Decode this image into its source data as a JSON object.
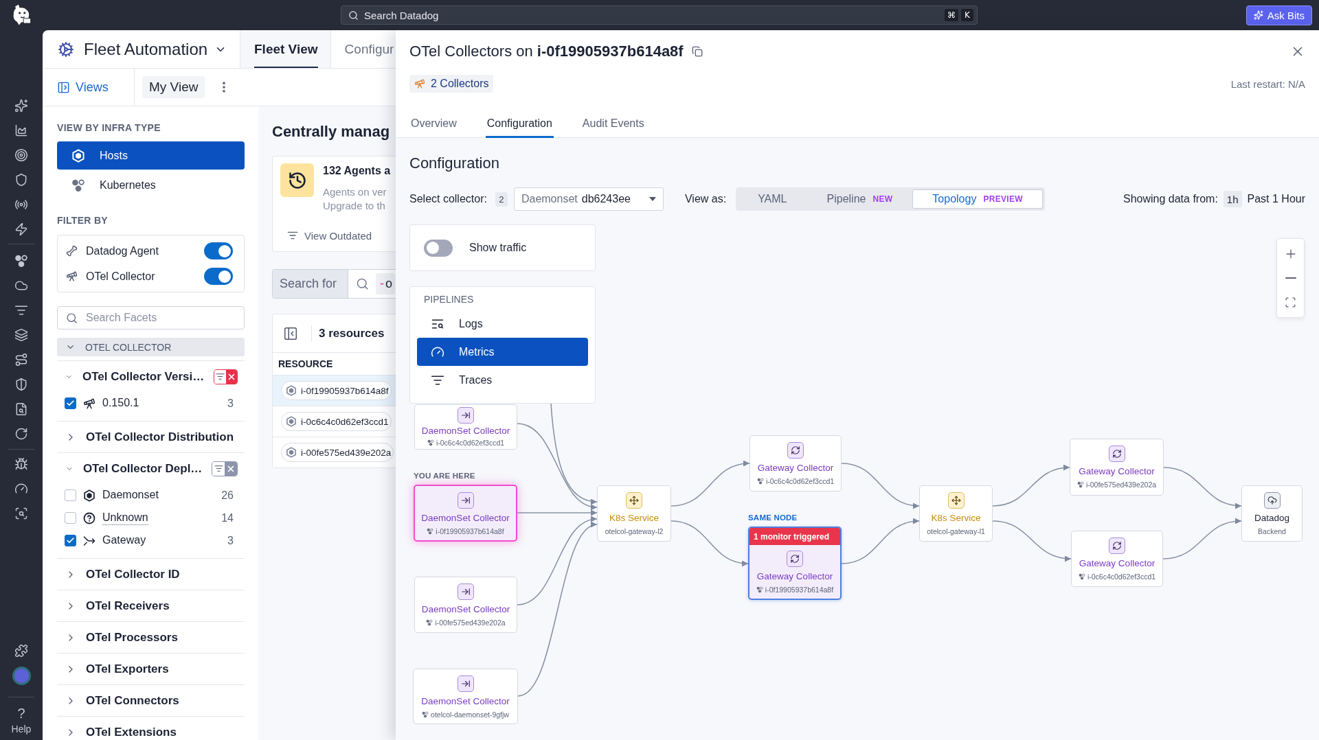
{
  "top_bar": {
    "search": {
      "placeholder": "Search Datadog",
      "shortcut": [
        "⌘",
        "K"
      ]
    },
    "ask_button": "Ask Bits"
  },
  "nav": {
    "help": {
      "glyph": "?",
      "label": "Help"
    }
  },
  "app": {
    "title": "Fleet Automation",
    "tabs": [
      {
        "label": "Fleet View",
        "selected": true
      },
      {
        "label": "Configur",
        "selected": false
      }
    ],
    "views_button": "Views",
    "current_view": "My View",
    "facets_panel": {
      "infra_title": "VIEW BY INFRA TYPE",
      "infra_types": [
        {
          "label": "Hosts",
          "kind": "host",
          "selected": true
        },
        {
          "label": "Kubernetes",
          "kind": "cluster",
          "selected": false
        }
      ],
      "filter_title": "FILTER BY",
      "filters": [
        {
          "label": "Datadog Agent",
          "kind": "agent",
          "on": true
        },
        {
          "label": "OTel Collector",
          "kind": "collector",
          "on": true
        }
      ],
      "search": {
        "placeholder": "Search Facets"
      },
      "group": {
        "label": "OTEL COLLECTOR",
        "expanded": true
      },
      "facets": [
        {
          "label": "OTel Collector Versi…",
          "expanded": true,
          "filtered": true,
          "clear_hovered": true,
          "values": [
            {
              "label": "0.150.1",
              "kind": "collector",
              "count": "3",
              "checked": true,
              "underlined": false
            }
          ]
        },
        {
          "label": "OTel Collector Distribution",
          "expanded": false,
          "filtered": false
        },
        {
          "label": "OTel Collector Depl…",
          "expanded": true,
          "filtered": true,
          "clear_hovered": false,
          "values": [
            {
              "label": "Daemonset",
              "kind": "daemonset",
              "count": "26",
              "checked": false,
              "underlined": false
            },
            {
              "label": "Unknown",
              "kind": "unknown",
              "count": "14",
              "checked": false,
              "underlined": true
            },
            {
              "label": "Gateway",
              "kind": "gateway",
              "count": "3",
              "checked": true,
              "underlined": false
            }
          ]
        },
        {
          "label": "OTel Collector ID",
          "expanded": false,
          "filtered": false
        },
        {
          "label": "OTel Receivers",
          "expanded": false,
          "filtered": false
        },
        {
          "label": "OTel Processors",
          "expanded": false,
          "filtered": false
        },
        {
          "label": "OTel Exporters",
          "expanded": false,
          "filtered": false
        },
        {
          "label": "OTel Connectors",
          "expanded": false,
          "filtered": false
        },
        {
          "label": "OTel Extensions",
          "expanded": false,
          "filtered": false
        }
      ]
    },
    "main": {
      "heading": "Centrally manag",
      "notice": {
        "title": "132 Agents a",
        "lines": [
          "Agents on ver",
          "Upgrade to th"
        ],
        "action": "View Outdated"
      },
      "query": {
        "label": "Search for",
        "sign": "-",
        "term": "o"
      },
      "resources": {
        "count": "3 resources",
        "column": "RESOURCE",
        "rows": [
          {
            "name": "i-0f19905937b614a8f",
            "selected": true
          },
          {
            "name": "i-0c6c4c0d62ef3ccd1",
            "selected": false
          },
          {
            "name": "i-00fe575ed439e202a",
            "selected": false
          }
        ]
      }
    }
  },
  "drawer": {
    "title": "OTel Collectors on **i-0f19905937b614a8f**",
    "collectors": "2 Collectors",
    "last_restart": "Last restart: N/A",
    "tabs": [
      {
        "label": "Overview",
        "selected": false
      },
      {
        "label": "Configuration",
        "selected": true
      },
      {
        "label": "Audit Events",
        "selected": false
      }
    ],
    "section_title": "Configuration",
    "collector_select": {
      "label": "Select collector:",
      "count": "2",
      "type": "Daemonset",
      "value": "db6243ee"
    },
    "view_as": {
      "label": "View as:",
      "options": [
        {
          "label": "YAML",
          "selected": false
        },
        {
          "label": "Pipeline",
          "badge": "NEW",
          "selected": false
        },
        {
          "label": "Topology",
          "badge": "PREVIEW",
          "selected": true
        }
      ]
    },
    "time_range": {
      "label": "Showing data from:",
      "shortcut": "1h",
      "value": "Past 1 Hour"
    },
    "topology": {
      "show_traffic": {
        "label": "Show traffic",
        "on": false
      },
      "pipelines": {
        "title": "PIPELINES",
        "items": [
          {
            "label": "Logs",
            "kind": "logs",
            "selected": false
          },
          {
            "label": "Metrics",
            "kind": "metrics",
            "selected": true
          },
          {
            "label": "Traces",
            "kind": "traces",
            "selected": false
          }
        ]
      },
      "nodes": [
        {
          "kind": "daemonset",
          "title": "DaemonSet Collector",
          "subtitle": "i-0c6c4c0d62ef3ccd1",
          "current": false,
          "same_node": false
        },
        {
          "kind": "daemonset",
          "title": "DaemonSet Collector",
          "subtitle": "i-0f19905937b614a8f",
          "tag": "YOU ARE HERE",
          "current": true,
          "same_node": false
        },
        {
          "kind": "daemonset",
          "title": "DaemonSet Collector",
          "subtitle": "i-00fe575ed439e202a",
          "current": false,
          "same_node": false
        },
        {
          "kind": "daemonset",
          "title": "DaemonSet Collector",
          "subtitle": "otelcol-daemonset-9gfjw",
          "current": false,
          "same_node": false
        },
        {
          "kind": "k8s_service",
          "title": "K8s Service",
          "subtitle": "otelcol-gateway-l2",
          "current": false,
          "same_node": false
        },
        {
          "kind": "gateway",
          "title": "Gateway Collector",
          "subtitle": "i-0c6c4c0d62ef3ccd1",
          "current": false,
          "same_node": false
        },
        {
          "kind": "gateway",
          "title": "Gateway Collector",
          "subtitle": "i-0f19905937b614a8f",
          "tag": "SAME NODE",
          "alert": "1 monitor triggered",
          "current": false,
          "same_node": true
        },
        {
          "kind": "k8s_service",
          "title": "K8s Service",
          "subtitle": "otelcol-gateway-l1",
          "current": false,
          "same_node": false
        },
        {
          "kind": "gateway",
          "title": "Gateway Collector",
          "subtitle": "i-00fe575ed439e202a",
          "current": false,
          "same_node": false
        },
        {
          "kind": "gateway",
          "title": "Gateway Collector",
          "subtitle": "i-0c6c4c0d62ef3ccd1",
          "current": false,
          "same_node": false
        },
        {
          "kind": "backend",
          "title": "Datadog",
          "subtitle": "Backend",
          "current": false,
          "same_node": false
        }
      ]
    }
  }
}
